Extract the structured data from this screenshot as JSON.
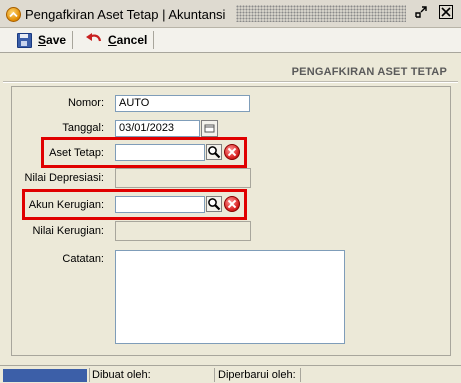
{
  "window": {
    "title": "Pengafkiran Aset Tetap | Akuntansi",
    "app_icon": "chevron-up-circle-icon",
    "restore_icon": "restore-icon",
    "close_icon": "close-icon"
  },
  "toolbar": {
    "save": {
      "mnemonic": "S",
      "rest": "ave",
      "icon": "floppy-disk-icon"
    },
    "cancel": {
      "mnemonic": "C",
      "rest": "ancel",
      "icon": "undo-arrow-icon"
    }
  },
  "form": {
    "heading": "PENGAFKIRAN ASET TETAP",
    "fields": {
      "nomor": {
        "label": "Nomor:",
        "value": "AUTO"
      },
      "tanggal": {
        "label": "Tanggal:",
        "value": "03/01/2023"
      },
      "aset_tetap": {
        "label": "Aset Tetap:",
        "value": ""
      },
      "nilai_depresiasi": {
        "label": "Nilai Depresiasi:",
        "value": ""
      },
      "akun_kerugian": {
        "label": "Akun Kerugian:",
        "value": ""
      },
      "nilai_kerugian": {
        "label": "Nilai Kerugian:",
        "value": ""
      },
      "catatan": {
        "label": "Catatan:",
        "value": ""
      }
    },
    "highlight_color": "#e00000"
  },
  "statusbar": {
    "dibuat_oleh": "Dibuat oleh:",
    "diperbarui_oleh": "Diperbarui oleh:",
    "progress_color": "#3c5fa8"
  }
}
